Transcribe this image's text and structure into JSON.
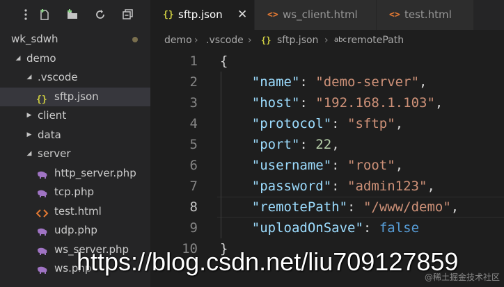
{
  "sidebar": {
    "toolbar_icons": [
      "dots-icon",
      "new-file-icon",
      "new-folder-icon",
      "refresh-icon",
      "collapse-all-icon"
    ],
    "rows": [
      {
        "label": "wk_sdwh",
        "indent": 0,
        "kind": "folder-collapsed-root",
        "dirty": true
      },
      {
        "label": "demo",
        "indent": 0,
        "kind": "folder-open"
      },
      {
        "label": ".vscode",
        "indent": 1,
        "kind": "folder-open"
      },
      {
        "label": "sftp.json",
        "indent": 2,
        "kind": "json",
        "selected": true
      },
      {
        "label": "client",
        "indent": 1,
        "kind": "folder-closed"
      },
      {
        "label": "data",
        "indent": 1,
        "kind": "folder-closed"
      },
      {
        "label": "server",
        "indent": 1,
        "kind": "folder-open"
      },
      {
        "label": "http_server.php",
        "indent": 2,
        "kind": "php"
      },
      {
        "label": "tcp.php",
        "indent": 2,
        "kind": "php"
      },
      {
        "label": "test.html",
        "indent": 2,
        "kind": "html"
      },
      {
        "label": "udp.php",
        "indent": 2,
        "kind": "php"
      },
      {
        "label": "ws_server.php",
        "indent": 2,
        "kind": "php"
      },
      {
        "label": "ws.php",
        "indent": 2,
        "kind": "php"
      }
    ]
  },
  "tabs": [
    {
      "label": "sftp.json",
      "icon": "{}",
      "active": true,
      "close": "✕"
    },
    {
      "label": "ws_client.html",
      "icon": "<>",
      "active": false
    },
    {
      "label": "test.html",
      "icon": "<>",
      "active": false
    }
  ],
  "breadcrumb": {
    "part1": "demo",
    "sep1": "›",
    "part2": ".vscode",
    "sep2": "›",
    "icon3": "{}",
    "part3": "sftp.json",
    "sep3": "›",
    "icon4": "abc",
    "part4": "remotePath"
  },
  "editor": {
    "current_line": 8,
    "line_numbers": [
      "1",
      "2",
      "3",
      "4",
      "5",
      "6",
      "7",
      "8",
      "9",
      "10"
    ],
    "lines": [
      [
        {
          "t": "{",
          "c": "p"
        }
      ],
      [
        {
          "t": "    ",
          "c": "p"
        },
        {
          "t": "\"name\"",
          "c": "k"
        },
        {
          "t": ": ",
          "c": "p"
        },
        {
          "t": "\"demo-server\"",
          "c": "s"
        },
        {
          "t": ",",
          "c": "p"
        }
      ],
      [
        {
          "t": "    ",
          "c": "p"
        },
        {
          "t": "\"host\"",
          "c": "k"
        },
        {
          "t": ": ",
          "c": "p"
        },
        {
          "t": "\"192.168.1.103\"",
          "c": "s"
        },
        {
          "t": ",",
          "c": "p"
        }
      ],
      [
        {
          "t": "    ",
          "c": "p"
        },
        {
          "t": "\"protocol\"",
          "c": "k"
        },
        {
          "t": ": ",
          "c": "p"
        },
        {
          "t": "\"sftp\"",
          "c": "s"
        },
        {
          "t": ",",
          "c": "p"
        }
      ],
      [
        {
          "t": "    ",
          "c": "p"
        },
        {
          "t": "\"port\"",
          "c": "k"
        },
        {
          "t": ": ",
          "c": "p"
        },
        {
          "t": "22",
          "c": "n"
        },
        {
          "t": ",",
          "c": "p"
        }
      ],
      [
        {
          "t": "    ",
          "c": "p"
        },
        {
          "t": "\"username\"",
          "c": "k"
        },
        {
          "t": ": ",
          "c": "p"
        },
        {
          "t": "\"root\"",
          "c": "s"
        },
        {
          "t": ",",
          "c": "p"
        }
      ],
      [
        {
          "t": "    ",
          "c": "p"
        },
        {
          "t": "\"password\"",
          "c": "k"
        },
        {
          "t": ": ",
          "c": "p"
        },
        {
          "t": "\"admin123\"",
          "c": "s"
        },
        {
          "t": ",",
          "c": "p"
        }
      ],
      [
        {
          "t": "    ",
          "c": "p"
        },
        {
          "t": "\"remotePath\"",
          "c": "k"
        },
        {
          "t": ": ",
          "c": "p"
        },
        {
          "t": "\"/www/demo\"",
          "c": "s"
        },
        {
          "t": ",",
          "c": "p"
        }
      ],
      [
        {
          "t": "    ",
          "c": "p"
        },
        {
          "t": "\"uploadOnSave\"",
          "c": "k"
        },
        {
          "t": ": ",
          "c": "p"
        },
        {
          "t": "false",
          "c": "b"
        }
      ],
      [
        {
          "t": "}",
          "c": "p"
        }
      ]
    ]
  },
  "watermark": "https://blog.csdn.net/liu709127859",
  "watermark_small": "@稀土掘金技术社区",
  "colors": {
    "json_icon": "#cbcb41",
    "html_icon": "#e37933",
    "php_icon": "#a074c4"
  }
}
